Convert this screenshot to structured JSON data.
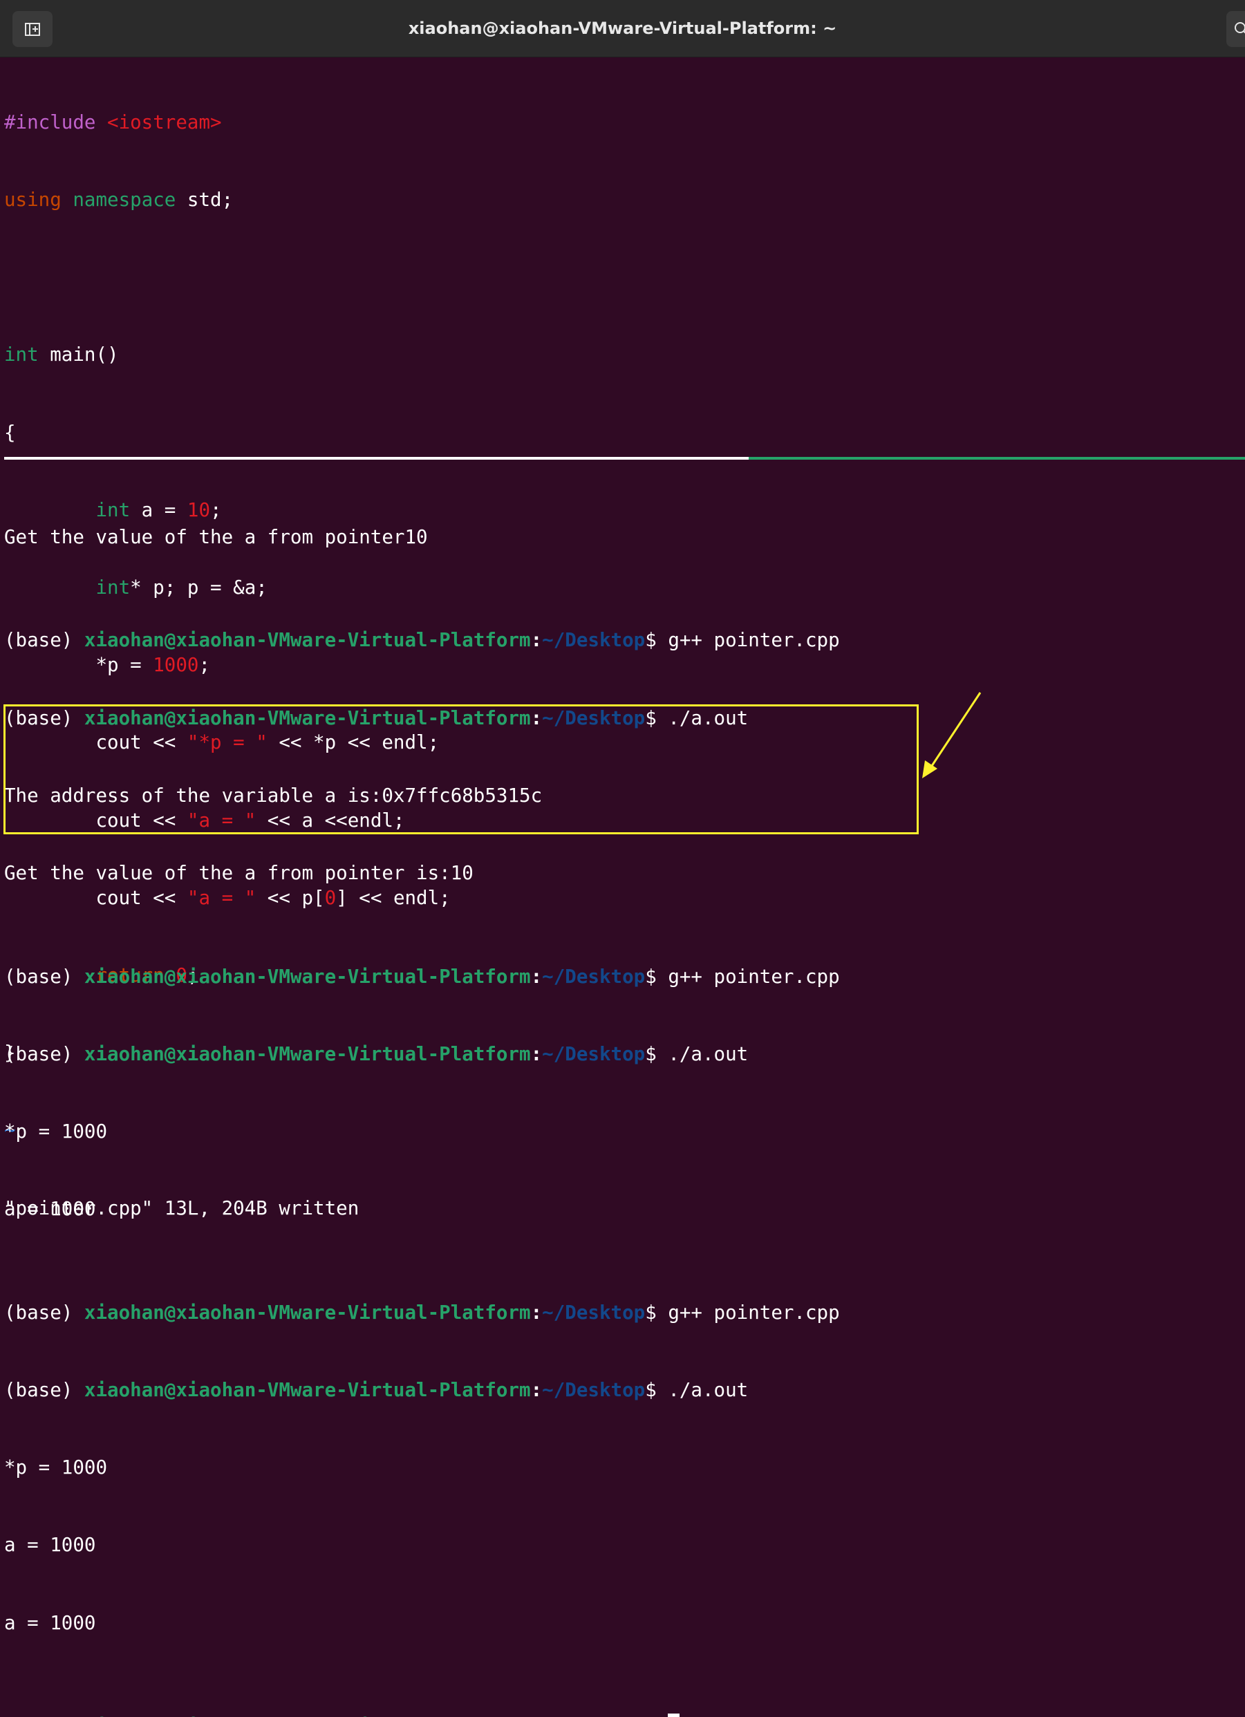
{
  "window": {
    "title": "xiaohan@xiaohan-VMware-Virtual-Platform: ~",
    "new_tab_icon": "new-tab-icon",
    "search_icon": "search-icon"
  },
  "editor": {
    "line1": {
      "a": "#include",
      "b": " ",
      "c": "<iostream>"
    },
    "line2": {
      "a": "using",
      "b": " ",
      "c": "namespace",
      "d": " std;"
    },
    "line3": "",
    "line4": {
      "a": "int",
      "b": " main()"
    },
    "line5": "{",
    "line6": {
      "a": "        ",
      "b": "int",
      "c": " a = ",
      "d": "10",
      "e": ";"
    },
    "line7": {
      "a": "        ",
      "b": "int",
      "c": "* p; p = &a;"
    },
    "line8": {
      "a": "        *p = ",
      "b": "1000",
      "c": ";"
    },
    "line9": {
      "a": "        cout << ",
      "b": "\"*p = \"",
      "c": " << *p << endl;"
    },
    "line10": {
      "a": "        cout << ",
      "b": "\"a = \"",
      "c": " << a <<endl;"
    },
    "line11": {
      "a": "        cout << ",
      "b": "\"a = \"",
      "c": " << p[",
      "d": "0",
      "e": "] << endl;"
    },
    "line12": {
      "a": "        ",
      "b": "return",
      "c": " ",
      "d": "0",
      "e": ";"
    },
    "line13": "}",
    "tilde": "~",
    "status": "\"pointer.cpp\" 13L, 204B written"
  },
  "terminal": {
    "prompt_prefix": "(base) ",
    "prompt_user": "xiaohan@xiaohan-VMware-Virtual-Platform",
    "prompt_colon": ":",
    "prompt_path": "~/Desktop",
    "prompt_dollar": "$ ",
    "out1": "Get the value of the a from pointer10",
    "cmd_compile": "g++ pointer.cpp",
    "cmd_run": "./a.out",
    "out2": "The address of the variable a is:0x7ffc68b5315c",
    "out3": "Get the value of the a from pointer is:10",
    "out_p": "*p = 1000",
    "out_a": "a = 1000"
  },
  "colors": {
    "background": "#300a24",
    "prompt_user": "#26a269",
    "prompt_path": "#12488b",
    "highlight": "#fff22d"
  }
}
